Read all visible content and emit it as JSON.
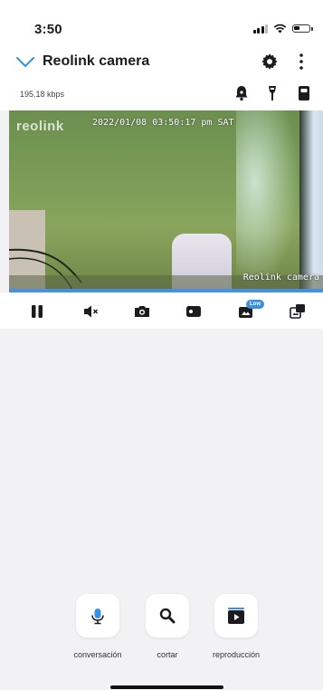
{
  "status_bar": {
    "time": "3:50"
  },
  "header": {
    "title": "Reolink camera"
  },
  "stream": {
    "bitrate": "195.18 kbps"
  },
  "video": {
    "logo": "reolink",
    "timestamp": "2022/01/08 03:50:17 pm SAT",
    "camera_name": "Reolink camera",
    "progress": 1.0
  },
  "controls": {
    "quality_badge": "Low",
    "icons": [
      "pause-icon",
      "mute-icon",
      "camera-icon",
      "record-icon",
      "quality-icon",
      "switch-view-icon"
    ]
  },
  "actions": [
    {
      "label": "conversación",
      "icon": "microphone-icon"
    },
    {
      "label": "cortar",
      "icon": "search-icon"
    },
    {
      "label": "reproducción",
      "icon": "playback-icon"
    }
  ],
  "colors": {
    "accent": "#3a8fe0",
    "progress": "#4a90e2",
    "back_chevron": "#3a8fe0"
  }
}
